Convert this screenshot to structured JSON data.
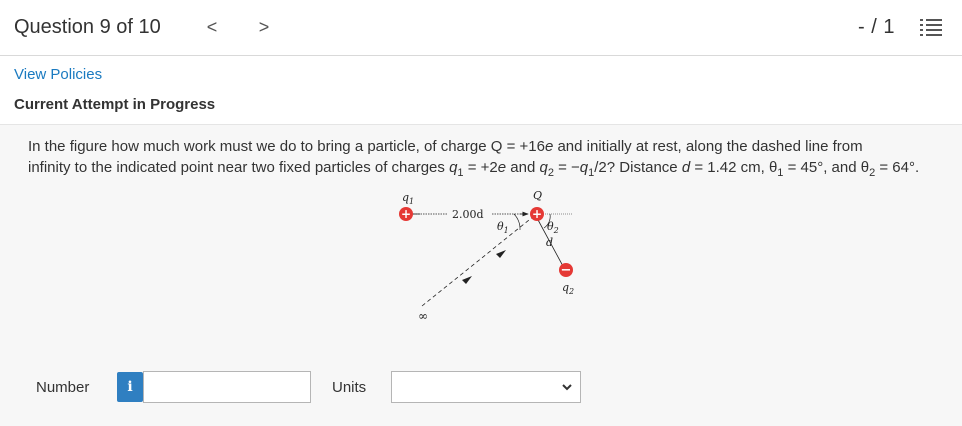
{
  "header": {
    "question_counter": "Question 9 of 10",
    "prev_glyph": "<",
    "next_glyph": ">",
    "score": "- / 1",
    "list_icon": "list-icon"
  },
  "links": {
    "view_policies": "View Policies"
  },
  "status": {
    "attempt": "Current Attempt in Progress"
  },
  "question": {
    "line1_a": "In the figure how much work must we do to bring a particle, of charge Q = +16",
    "line1_b": "e",
    "line1_c": " and initially at rest, along the dashed line from",
    "line2_a": "infinity to the indicated point near two fixed particles of charges ",
    "q1": "q",
    "q1_sub": "1",
    "mid1": " = +2",
    "e2": "e",
    "mid2": " and ",
    "q2": "q",
    "q2_sub": "2",
    "mid3": " = −",
    "q1b": "q",
    "q1b_sub": "1",
    "mid4": "/2? Distance ",
    "d": "d",
    "tail": " = 1.42 cm, θ",
    "th1_sub": "1",
    "tail2": " = 45°, and θ",
    "th2_sub": "2",
    "tail3": " = 64°."
  },
  "figure": {
    "q1_label": "q",
    "q1_sub": "1",
    "Q_label": "Q",
    "q2_label": "q",
    "q2_sub": "2",
    "distance_label": "2.00d",
    "theta1": "θ",
    "theta1_sub": "1",
    "theta2": "θ",
    "theta2_sub": "2",
    "d_label": "d",
    "infinity": "∞",
    "plus": "+",
    "minus": "−",
    "charge_color": "#e53935"
  },
  "answer": {
    "number_label": "Number",
    "info_glyph": "i",
    "number_value": "",
    "units_label": "Units",
    "units_value": ""
  },
  "colors": {
    "link": "#1a7ac0",
    "info_button": "#2f7fc1",
    "question_bg": "#f7f7f7"
  }
}
